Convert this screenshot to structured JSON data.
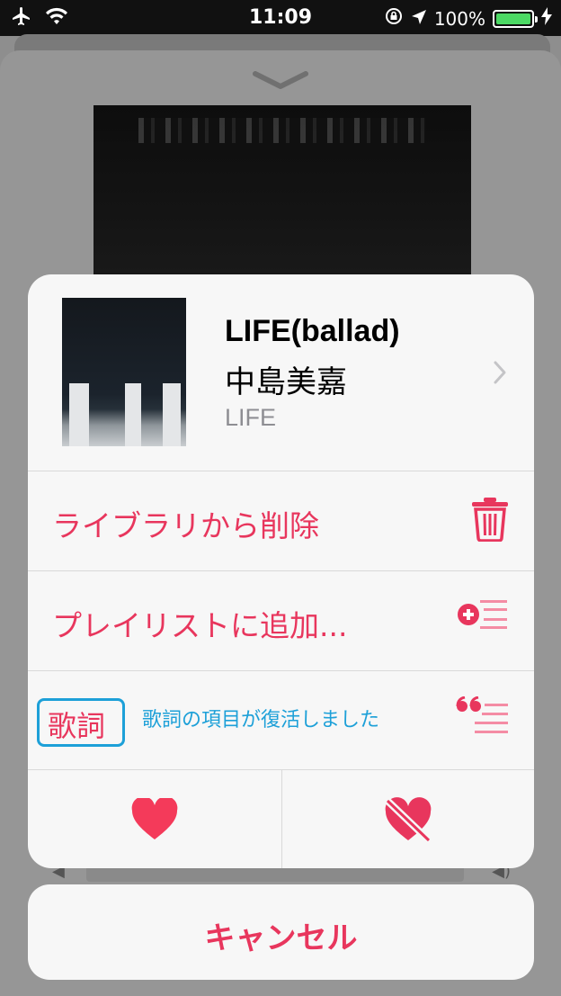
{
  "status_bar": {
    "time": "11:09",
    "battery": "100%",
    "icons": [
      "airplane-icon",
      "wifi-icon",
      "orientation-lock-icon",
      "location-icon",
      "battery-icon",
      "charging-icon"
    ]
  },
  "song": {
    "title": "LIFE(ballad)",
    "artist": "中島美嘉",
    "album": "LIFE"
  },
  "actions": {
    "remove_from_library": "ライブラリから削除",
    "add_to_playlist": "プレイリストに追加...",
    "lyrics": "歌詞",
    "lyrics_note": "歌詞の項目が復活しました"
  },
  "cancel_label": "キャンセル",
  "colors": {
    "accent": "#e8365d",
    "annotation": "#1da0d8",
    "sheet_bg": "#f7f7f7",
    "battery_green": "#4cd964"
  }
}
